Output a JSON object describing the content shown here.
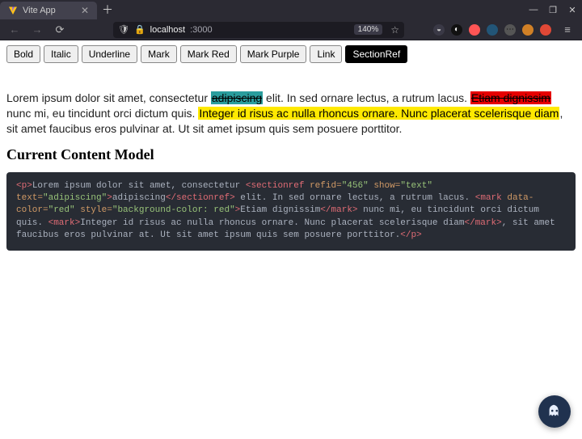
{
  "browser": {
    "tab_title": "Vite App",
    "url_host": "localhost",
    "url_port": ":3000",
    "zoom": "140%",
    "win": {
      "min": "—",
      "max": "❐",
      "close": "✕"
    }
  },
  "toolbar": {
    "buttons": [
      {
        "label": "Bold",
        "active": false
      },
      {
        "label": "Italic",
        "active": false
      },
      {
        "label": "Underline",
        "active": false
      },
      {
        "label": "Mark",
        "active": false
      },
      {
        "label": "Mark Red",
        "active": false
      },
      {
        "label": "Mark Purple",
        "active": false
      },
      {
        "label": "Link",
        "active": false
      },
      {
        "label": "SectionRef",
        "active": true
      }
    ]
  },
  "paragraph": {
    "t0": "Lorem ipsum dolor sit amet, consectetur ",
    "teal": "adipiscing",
    "t1": " elit. In sed ornare lectus, a rutrum lacus. ",
    "red": "Etiam dignissim",
    "t2": " nunc mi, eu tincidunt orci dictum quis. ",
    "yellow": "Integer id risus ac nulla rhoncus ornare. Nunc placerat scelerisque diam",
    "t3": ", sit amet faucibus eros pulvinar at. Ut sit amet ipsum quis sem posuere porttitor."
  },
  "heading": "Current Content Model",
  "code": {
    "p_open": "<p>",
    "txt0": "Lorem ipsum dolor sit amet, consectetur ",
    "sr_open": "<sectionref",
    "sr_attr1": " refid=",
    "sr_val1": "\"456\"",
    "sr_attr2": " show=",
    "sr_val2": "\"text\"",
    "sr_attr3": " text=",
    "sr_val3": "\"adipiscing\"",
    "sr_close_open": ">",
    "sr_inner": "adipiscing",
    "sr_close": "</sectionref>",
    "txt1": " elit. In sed ornare lectus, a rutrum lacus. ",
    "mk1_open": "<mark",
    "mk1_a1": " data-color=",
    "mk1_v1": "\"red\"",
    "mk1_a2": " style=",
    "mk1_v2": "\"background-color: red\"",
    "mk1_close_open": ">",
    "mk1_inner": "Etiam dignissim",
    "mk1_close": "</mark>",
    "txt2": " nunc mi, eu tincidunt orci dictum quis. ",
    "mk2_open": "<mark>",
    "mk2_inner": "Integer id risus ac nulla rhoncus ornare. Nunc placerat scelerisque diam",
    "mk2_close": "</mark>",
    "txt3": ", sit amet faucibus eros pulvinar at. Ut sit amet ipsum quis sem posuere porttitor.",
    "p_close": "</p>"
  }
}
